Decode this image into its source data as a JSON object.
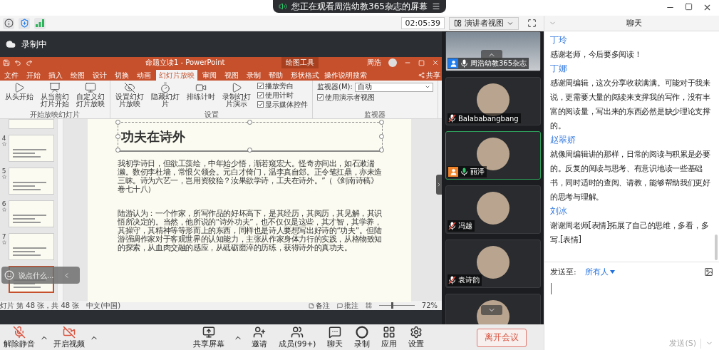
{
  "window": {
    "banner": "您正在观看周浩幼教365杂志的屏幕"
  },
  "info_bar": {
    "time": "02:05:39",
    "view_button": "演讲者视图"
  },
  "recording": {
    "label": "录制中"
  },
  "powerpoint": {
    "title": "命题立读1 - PowerPoint",
    "context_tab": "绘图工具",
    "user": "周浩",
    "share": "共享",
    "tabs": [
      {
        "label": "文件",
        "selected": false
      },
      {
        "label": "开始",
        "selected": false
      },
      {
        "label": "插入",
        "selected": false
      },
      {
        "label": "绘图",
        "selected": false
      },
      {
        "label": "设计",
        "selected": false
      },
      {
        "label": "切换",
        "selected": false
      },
      {
        "label": "动画",
        "selected": false
      },
      {
        "label": "幻灯片放映",
        "selected": true
      },
      {
        "label": "审阅",
        "selected": false
      },
      {
        "label": "视图",
        "selected": false
      },
      {
        "label": "录制",
        "selected": false
      },
      {
        "label": "帮助",
        "selected": false
      },
      {
        "label": "形状格式",
        "selected": false
      }
    ],
    "search": "操作说明搜索",
    "ribbon": [
      {
        "label": "开始放映幻灯片",
        "items": [
          {
            "kind": "button",
            "label": "从头开始"
          },
          {
            "kind": "button",
            "label": "从当前幻灯片开始"
          },
          {
            "kind": "button",
            "label": "自定义幻灯片放映"
          }
        ]
      },
      {
        "label": "设置",
        "items": [
          {
            "kind": "button",
            "label": "设置幻灯片放映"
          },
          {
            "kind": "button",
            "label": "隐藏幻灯片"
          },
          {
            "kind": "button",
            "label": "排练计时"
          },
          {
            "kind": "button",
            "label": "录制幻灯片演示"
          },
          {
            "kind": "checkbox",
            "label": "播放旁白",
            "checked": true
          },
          {
            "kind": "checkbox",
            "label": "使用计时",
            "checked": true
          },
          {
            "kind": "checkbox",
            "label": "显示媒体控件",
            "checked": true
          }
        ]
      },
      {
        "label": "监视器",
        "items": [
          {
            "kind": "select",
            "label": "监视器(M):",
            "value": "自动"
          },
          {
            "kind": "checkbox",
            "label": "使用演示者视图",
            "checked": true
          }
        ]
      }
    ],
    "thumbnails": [
      {
        "selected": false
      },
      {
        "number": "4",
        "selected": false
      },
      {
        "number": "5",
        "selected": false
      },
      {
        "number": "6",
        "selected": false
      },
      {
        "number": "7",
        "selected": false
      },
      {
        "selected": true
      }
    ],
    "comment_field": {
      "placeholder": "说点什么..."
    },
    "slide": {
      "title": "功夫在诗外",
      "paragraphs": [
        "我初学诗日，但欲工藻绘，中年始少悟，渐若窥宏大。怪奇亦间出，如石漱湍濑。数仞李杜墙，常恨欠领会。元白才倚门，温李真自郐。正令笔扛鼎，亦未造三昧。诗为六艺一，岂用资狡狯？汝果欲学诗，工夫在诗外。”（《剑南诗稿》卷七十八）",
        "陆游认为：一个作家，所写作品的好坏高下，是其经历，其阅历，其见解，其识悟所决定的。当然，他所说的“诗外功夫”，也不仅仅是这些，其才智，其学养，其操守，其精神等等形而上的东西，同样也是诗人要想写出好诗的“功夫”。但陆游强调作家对于客观世界的认知能力，主张从作家身体力行的实践，从格物致知的探索，从血肉交融的感应，从砥砺磨淬的历练，获得诗外的真功夫。"
      ]
    },
    "status_bar": {
      "slide_info": "灯片 第 48 张，共 48 张",
      "language": "中文(中国)",
      "notes": "备注",
      "comments": "批注",
      "zoom": "72%",
      "level": 0.35
    }
  },
  "participants": [
    {
      "kind": "video",
      "name": "周浩幼教365杂志",
      "muted": false,
      "speaking": false,
      "color": "#1e7cf0"
    },
    {
      "kind": "avatar",
      "name": "Balababangbang",
      "muted": true,
      "speaking": false
    },
    {
      "kind": "avatar",
      "name": "丽泽",
      "muted": false,
      "speaking": true,
      "color": "#f0832a"
    },
    {
      "kind": "avatar",
      "name": "冯越",
      "muted": true,
      "speaking": false
    },
    {
      "kind": "avatar",
      "name": "袁诗韵",
      "muted": true,
      "speaking": false
    },
    {
      "kind": "avatar",
      "speaking": false
    }
  ],
  "toolbar": [
    {
      "kind": "mic",
      "label": "解除静音",
      "menu": true
    },
    {
      "kind": "camera",
      "label": "开启视频",
      "menu": true
    },
    {
      "kind": "share",
      "label": "共享屏幕",
      "menu": true
    },
    {
      "kind": "invite",
      "label": "邀请",
      "menu": false
    },
    {
      "kind": "members",
      "label": "成员(99+)",
      "menu": false
    },
    {
      "kind": "chat",
      "label": "聊天",
      "menu": false
    },
    {
      "kind": "record",
      "label": "录制",
      "menu": false
    },
    {
      "kind": "apps",
      "label": "应用",
      "menu": false
    },
    {
      "kind": "settings",
      "label": "设置",
      "menu": false
    }
  ],
  "leave_button": "离开会议",
  "chat": {
    "title": "聊天",
    "messages": [
      {
        "sender": "丁玲",
        "text": "感谢老师，今后要多阅读！"
      },
      {
        "sender": "丁娜",
        "text": "感谢周编辑，这次分享收获满满。可能对于我来说，更需要大量的阅读来支撑我的写作，没有丰富的阅读量，写出来的东西必然是缺少理论支撑的。"
      },
      {
        "sender": "赵翠娇",
        "text": "就像周编辑讲的那样，日常的阅读与积累是必要的。反复的阅读与思考、有意识地读一些基础书，同时适时的查阅、请教，能够帮助我们更好的思考与理解。"
      },
      {
        "sender": "刘冰",
        "text": "谢谢周老师[表情]拓展了自己的思维，多看，多写.[表情]"
      }
    ],
    "send_to_label": "发送至:",
    "recipient": "所有人",
    "send_button": "发送(S)"
  }
}
